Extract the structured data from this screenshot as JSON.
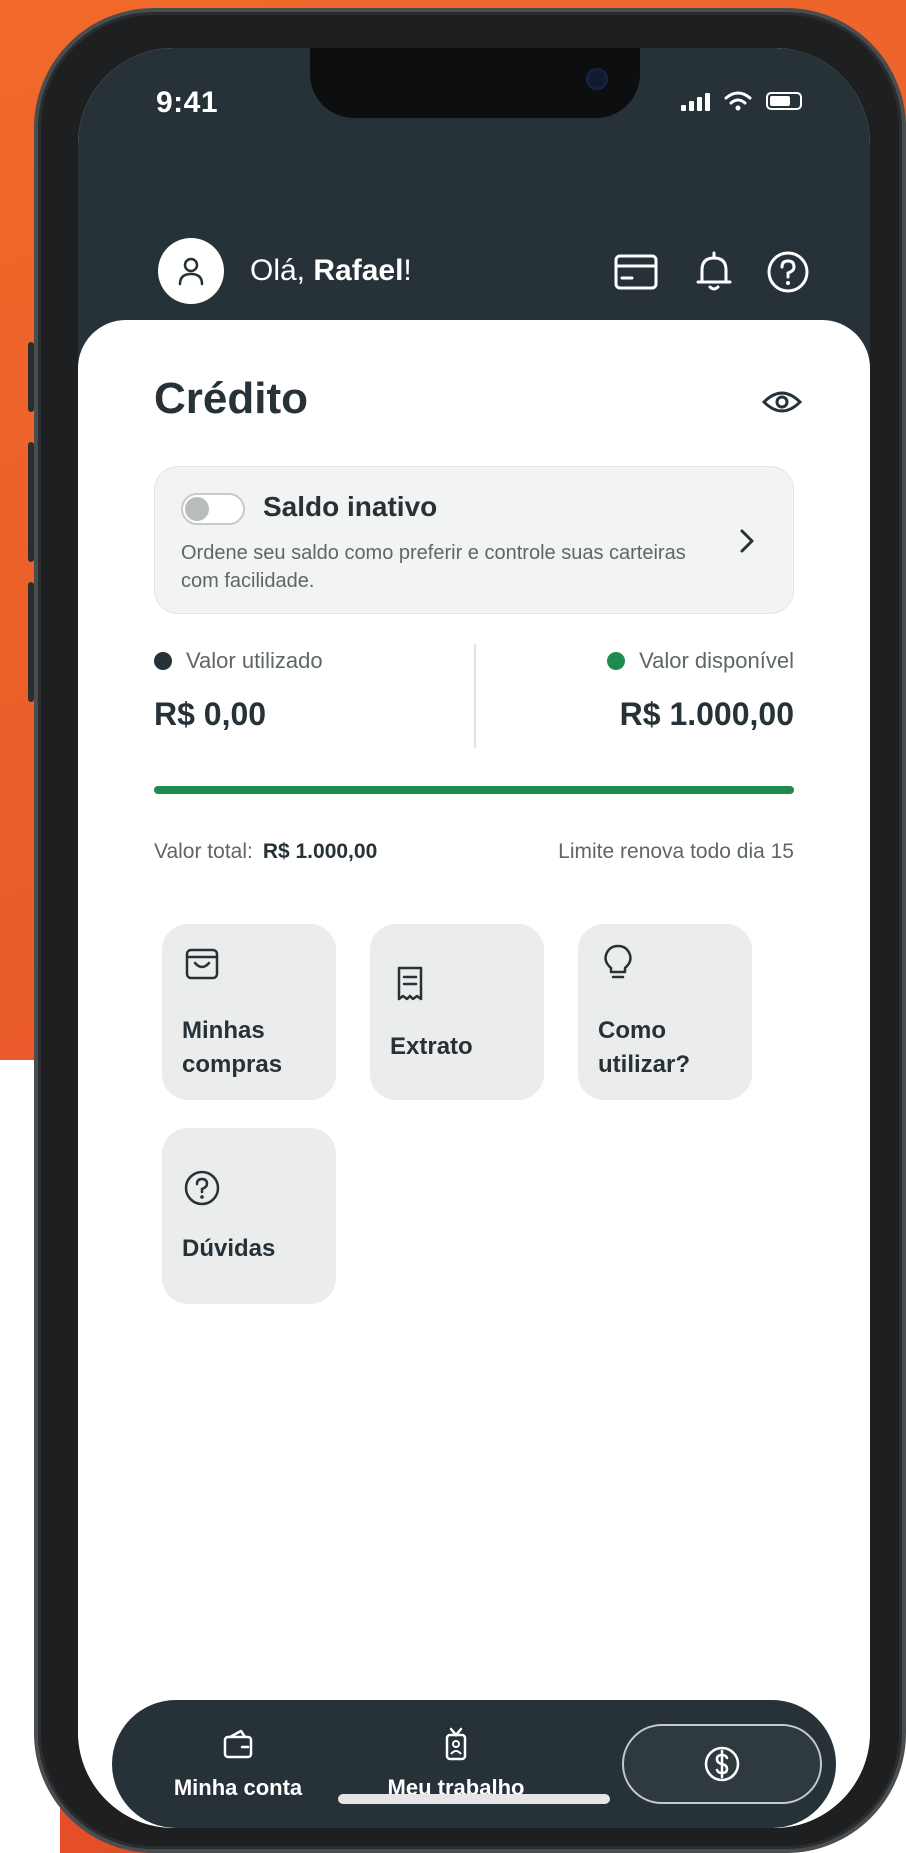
{
  "status_bar": {
    "time": "9:41"
  },
  "header": {
    "greeting_prefix": "Olá, ",
    "user_name": "Rafael",
    "greeting_suffix": "!"
  },
  "credit": {
    "title": "Crédito",
    "saldo_card": {
      "title": "Saldo inativo",
      "description": "Ordene seu saldo como preferir e controle suas carteiras com facilidade.",
      "toggle_on": false
    },
    "used": {
      "label": "Valor utilizado",
      "value": "R$ 0,00",
      "color": "#263238"
    },
    "available": {
      "label": "Valor disponível",
      "value": "R$ 1.000,00",
      "color": "#1e8a4e"
    },
    "available_fraction": 1.0,
    "total_label": "Valor total:",
    "total_value": "R$ 1.000,00",
    "renew_text": "Limite renova todo dia 15"
  },
  "tiles": [
    {
      "label_line1": "Minhas",
      "label_line2": "compras",
      "icon": "shopping-bag-icon"
    },
    {
      "label_line1": "Extrato",
      "label_line2": "",
      "icon": "receipt-icon"
    },
    {
      "label_line1": "Como",
      "label_line2": "utilizar?",
      "icon": "lightbulb-icon"
    },
    {
      "label_line1": "Dúvidas",
      "label_line2": "",
      "icon": "question-circle-icon"
    }
  ],
  "bottom_nav": {
    "items": [
      {
        "label": "Minha conta",
        "icon": "wallet-icon"
      },
      {
        "label": "Meu trabalho",
        "icon": "badge-icon"
      }
    ],
    "active_icon": "dollar-circle-icon"
  },
  "colors": {
    "dark": "#263238",
    "accent_green": "#1e8a4e",
    "brand_orange": "#e8572a"
  }
}
